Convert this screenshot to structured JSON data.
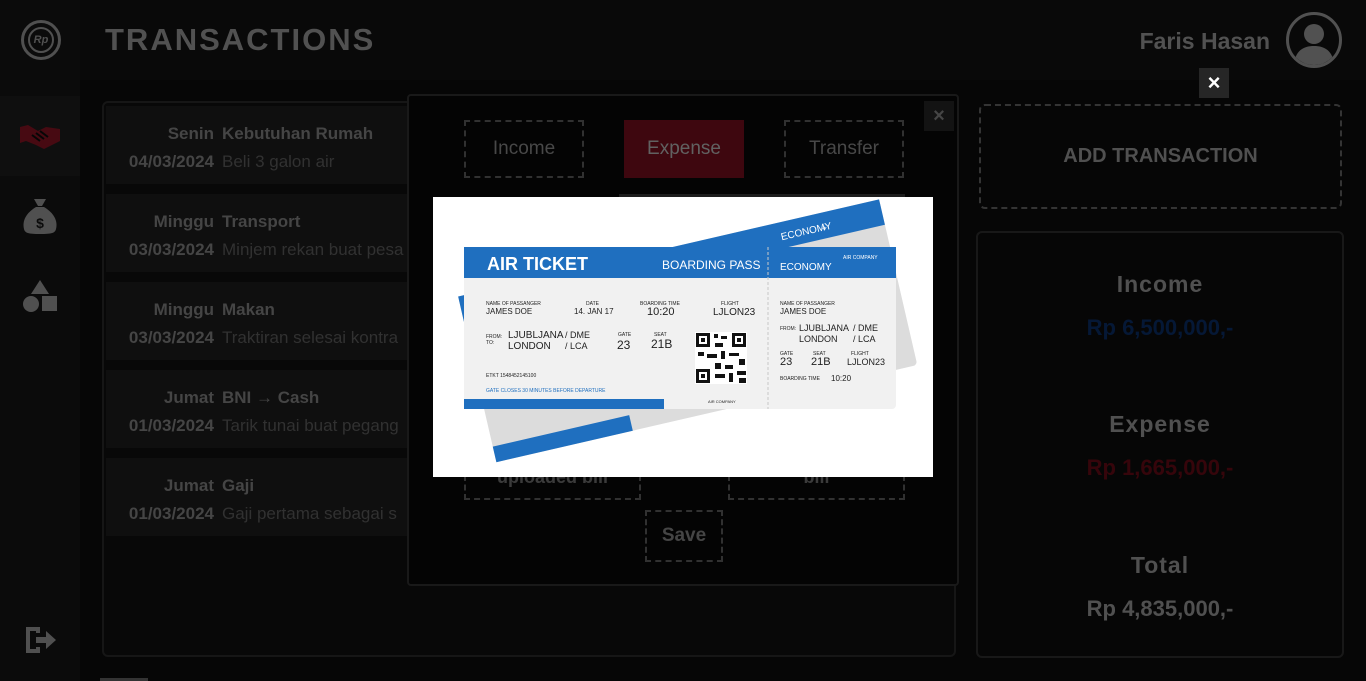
{
  "logo": {
    "text": "Rp"
  },
  "header": {
    "title": "TRANSACTIONS",
    "user_name": "Faris Hasan"
  },
  "sidebar": {
    "items": [
      {
        "icon": "handshake-icon",
        "active": true
      },
      {
        "icon": "money-bag-icon",
        "active": false
      },
      {
        "icon": "shapes-icon",
        "active": false
      }
    ],
    "logout_icon": "logout-icon"
  },
  "transactions": [
    {
      "day": "Senin",
      "date": "04/03/2024",
      "category": "Kebutuhan Rumah",
      "note": "Beli 3 galon air"
    },
    {
      "day": "Minggu",
      "date": "03/03/2024",
      "category": "Transport",
      "note": "Minjem rekan buat pesa"
    },
    {
      "day": "Minggu",
      "date": "03/03/2024",
      "category": "Makan",
      "note": "Traktiran selesai kontra"
    },
    {
      "day": "Jumat",
      "date": "01/03/2024",
      "category": "BNI → Cash",
      "note": "Tarik tunai buat pegang"
    },
    {
      "day": "Jumat",
      "date": "01/03/2024",
      "category": "Gaji",
      "note": "Gaji pertama sebagai s"
    }
  ],
  "add_transaction": {
    "label": "ADD TRANSACTION"
  },
  "summary": {
    "income_label": "Income",
    "income_value": "Rp 6,500,000,-",
    "expense_label": "Expense",
    "expense_value": "Rp 1,665,000,-",
    "total_label": "Total",
    "total_value": "Rp 4,835,000,-",
    "colors": {
      "income": "#0a2a5e",
      "expense": "#5e0a14",
      "total": "#8a8a8a"
    }
  },
  "modal": {
    "close_glyph": "×",
    "types": [
      {
        "label": "Income",
        "active": false
      },
      {
        "label": "Expense",
        "active": true
      },
      {
        "label": "Transfer",
        "active": false
      }
    ],
    "uploaded_bill_label": "uploaded bill",
    "bill_label": "bill",
    "save_label": "Save",
    "accent_color": "#6b0d1a"
  },
  "lightbox": {
    "close_glyph": "×",
    "ticket": {
      "title": "AIR TICKET",
      "pass_label": "BOARDING PASS",
      "class_label": "ECONOMY",
      "company": "AIR COMPANY",
      "passenger_label": "NAME OF PASSANGER",
      "passenger": "JAMES DOE",
      "date_label": "DATE",
      "date": "14. JAN 17",
      "boarding_time_label": "BOARDING TIME",
      "boarding_time": "10:20",
      "flight_label": "FLIGHT",
      "flight": "LJLON23",
      "from_label": "FROM:",
      "to_label": "TO:",
      "from": "LJUBLJANA",
      "from_code": "/ DME",
      "to": "LONDON",
      "to_code": "/ LCA",
      "gate_label": "GATE",
      "gate": "23",
      "seat_label": "SEAT",
      "seat": "21B",
      "etkt": "ETKT 1548452145100",
      "gate_closes": "GATE CLOSES 30 MINUTES BEFORE DEPARTURE",
      "accent_color": "#1f6fbf"
    }
  }
}
